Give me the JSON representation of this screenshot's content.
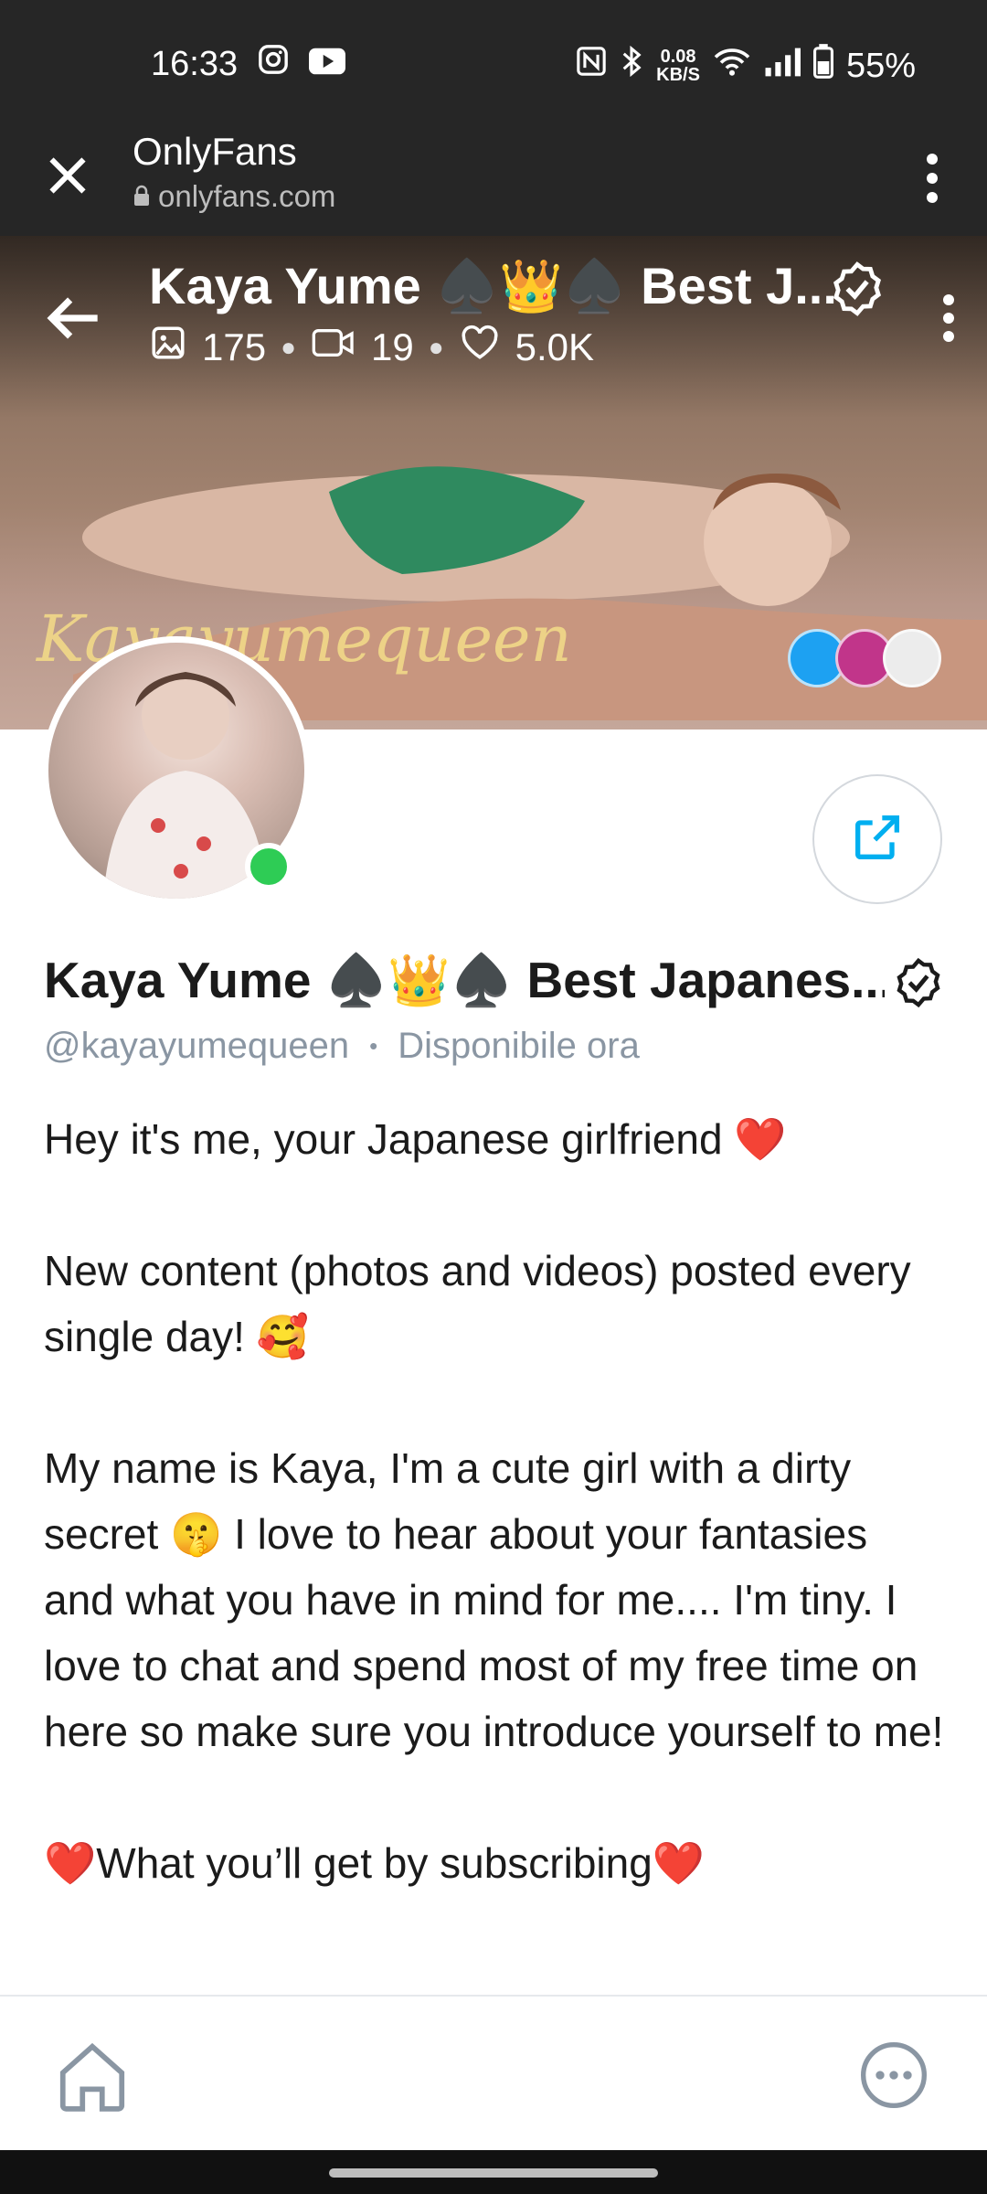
{
  "status_bar": {
    "time": "16:33",
    "speed_value": "0.08",
    "speed_unit": "KB/S",
    "battery": "55%",
    "icons": [
      "instagram-icon",
      "youtube-icon",
      "nfc-icon",
      "bluetooth-icon",
      "wifi-icon",
      "signal-icon",
      "battery-icon"
    ]
  },
  "browser": {
    "title": "OnlyFans",
    "url": "onlyfans.com"
  },
  "cover": {
    "title": "Kaya Yume ♠️👑♠️ Best J...",
    "stats": {
      "photos": "175",
      "videos": "19",
      "likes": "5.0K"
    },
    "watermark": "Kayayumequeen"
  },
  "profile": {
    "name": "Kaya Yume ♠️👑♠️ Best Japanes...",
    "handle": "@kayayumequeen",
    "availability": "Disponibile ora",
    "bio": [
      "Hey it's me, your Japanese girlfriend ❤️",
      "",
      "New content (photos and videos) posted every single day! 🥰",
      "",
      "My name is Kaya, I'm a cute girl with a dirty secret 🤫 I love to hear about your fantasies and what you have in mind for me.... I'm tiny. I love to chat and spend most of my free time on here so make sure you introduce yourself to me!",
      "",
      "❤️What you’ll get by subscribing❤️"
    ]
  },
  "colors": {
    "accent": "#00aff0",
    "online": "#2ecc55",
    "muted": "#8a96a3",
    "bar": "#262626"
  }
}
